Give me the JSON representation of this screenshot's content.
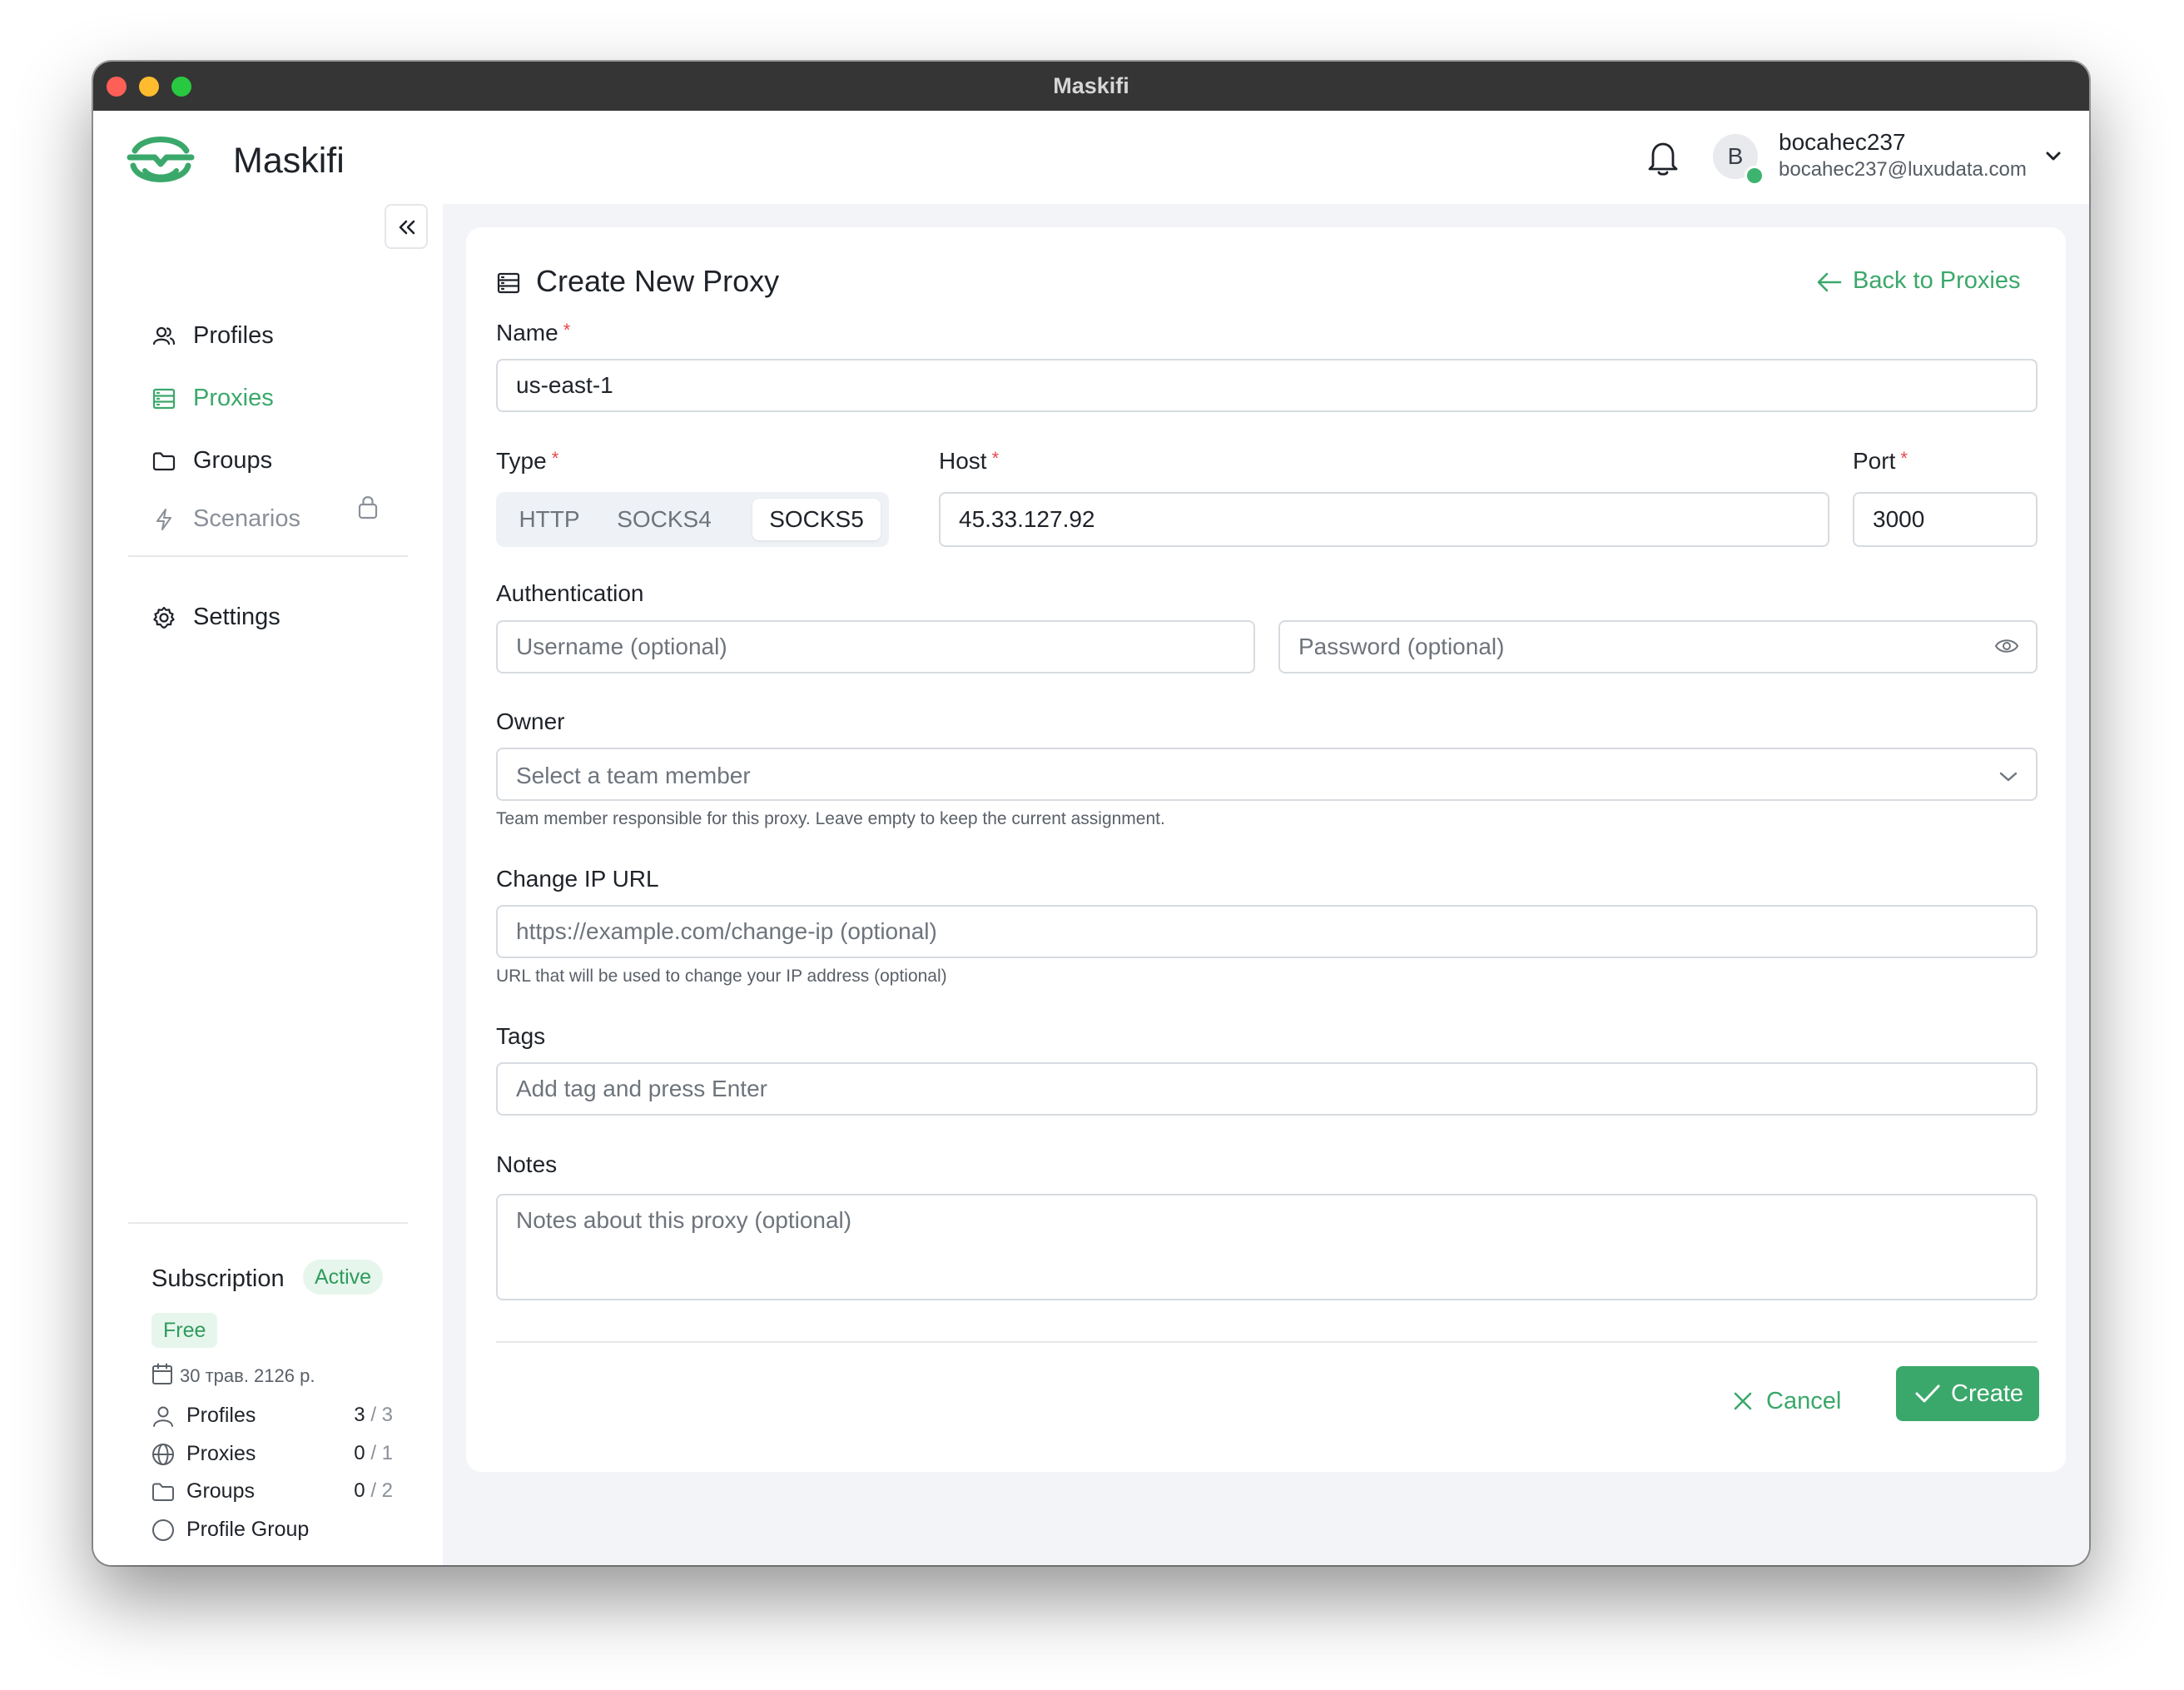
{
  "window": {
    "title": "Maskifi"
  },
  "header": {
    "app_name": "Maskifi",
    "user": {
      "initial": "B",
      "name": "bocahec237",
      "email": "bocahec237@luxudata.com"
    }
  },
  "sidebar": {
    "nav": [
      {
        "label": "Profiles",
        "icon": "users-icon"
      },
      {
        "label": "Proxies",
        "icon": "server-icon",
        "active": true
      },
      {
        "label": "Groups",
        "icon": "folder-icon"
      },
      {
        "label": "Scenarios",
        "icon": "bolt-icon",
        "locked": true
      },
      {
        "label": "Settings",
        "icon": "gear-icon"
      }
    ],
    "subscription": {
      "title": "Subscription",
      "status": "Active",
      "plan": "Free",
      "date": "30 трав. 2126 р.",
      "usage": [
        {
          "label": "Profiles",
          "used": "3",
          "limit": "/ 3"
        },
        {
          "label": "Proxies",
          "used": "0",
          "limit": "/ 1"
        },
        {
          "label": "Groups",
          "used": "0",
          "limit": "/ 2"
        },
        {
          "label": "Profile Group"
        }
      ]
    }
  },
  "form": {
    "title": "Create New Proxy",
    "back_label": "Back to Proxies",
    "name": {
      "label": "Name",
      "value": "us-east-1"
    },
    "type": {
      "label": "Type",
      "options": [
        "HTTP",
        "SOCKS4",
        "SOCKS5"
      ],
      "selected": "SOCKS5"
    },
    "host": {
      "label": "Host",
      "value": "45.33.127.92"
    },
    "port": {
      "label": "Port",
      "value": "3000"
    },
    "auth": {
      "label": "Authentication",
      "username_placeholder": "Username (optional)",
      "password_placeholder": "Password (optional)"
    },
    "owner": {
      "label": "Owner",
      "placeholder": "Select a team member",
      "helper": "Team member responsible for this proxy. Leave empty to keep the current assignment."
    },
    "change_ip": {
      "label": "Change IP URL",
      "placeholder": "https://example.com/change-ip (optional)",
      "helper": "URL that will be used to change your IP address (optional)"
    },
    "tags": {
      "label": "Tags",
      "placeholder": "Add tag and press Enter"
    },
    "notes": {
      "label": "Notes",
      "placeholder": "Notes about this proxy (optional)"
    },
    "cancel_label": "Cancel",
    "create_label": "Create"
  },
  "colors": {
    "accent": "#3aa86a",
    "required": "#e5484d",
    "titlebar": "#353535"
  }
}
